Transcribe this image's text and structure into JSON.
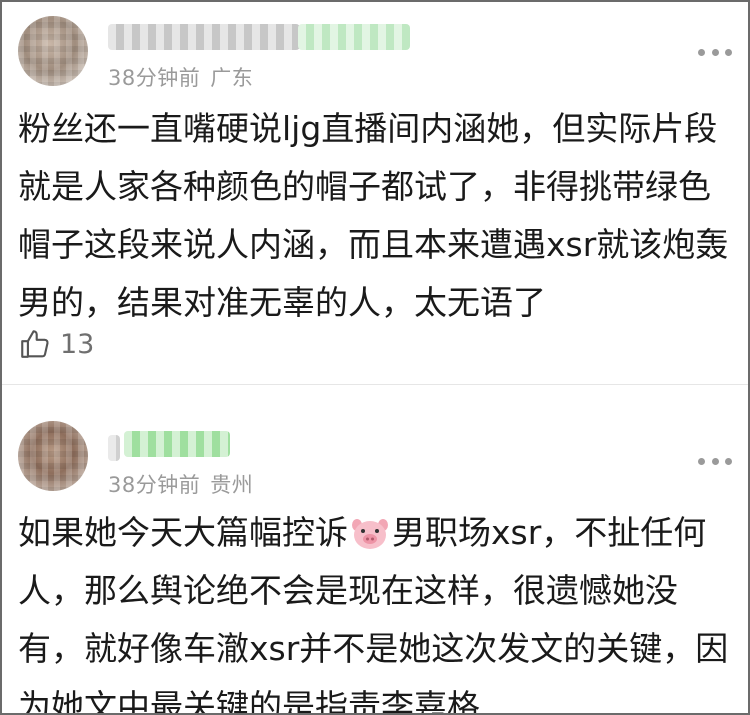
{
  "comments": [
    {
      "time": "38分钟前",
      "location": "广东",
      "text": "粉丝还一直嘴硬说ljg直播间内涵她，但实际片段就是人家各种颜色的帽子都试了，非得挑带绿色帽子这段来说人内涵，而且本来遭遇xsr就该炮轰男的，结果对准无辜的人，太无语了",
      "likes": "13"
    },
    {
      "time": "38分钟前",
      "location": "贵州",
      "text_before_emoji": "如果她今天大篇幅控诉",
      "emoji": "pig-face-emoji",
      "text_after_emoji": "男职场xsr，不扯任何人，那么舆论绝不会是现在这样，很遗憾她没有，就好像车澈xsr并不是她这次发文的关键，因为她文中最关键的是指责李嘉格"
    }
  ],
  "colors": {
    "text": "#1a1a1a",
    "meta": "#9a9a9a",
    "border": "#6b6b6b",
    "blur_green": "#9fdf9f"
  },
  "icons": {
    "more": "more-dots-icon",
    "like": "thumbs-up-icon"
  }
}
